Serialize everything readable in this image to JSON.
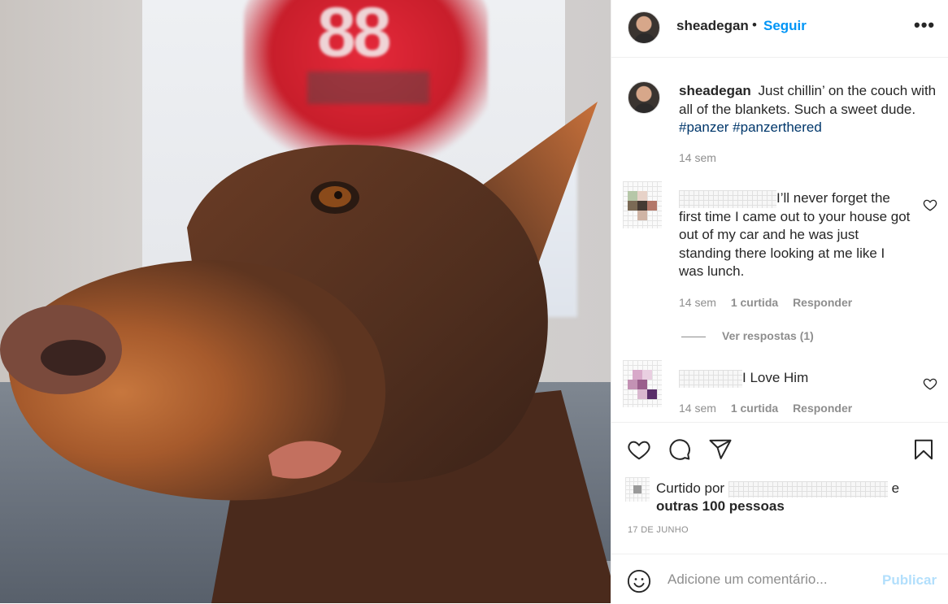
{
  "post": {
    "username": "sheadegan",
    "follow_label": "Seguir",
    "separator": "•",
    "more_label": "•••"
  },
  "caption": {
    "username": "sheadegan",
    "text": "Just chillin’ on the couch with all of the blankets. Such a sweet dude.",
    "hashtags": [
      "#panzer",
      "#panzerthered"
    ],
    "time": "14 sem"
  },
  "comments": [
    {
      "text": "I’ll never forget the first time I came out to your house got out of my car and he was just standing there looking at me like I was lunch.",
      "time": "14 sem",
      "likes": "1 curtida",
      "reply_label": "Responder"
    },
    {
      "text": "I Love Him",
      "time": "14 sem",
      "likes": "1 curtida",
      "reply_label": "Responder"
    }
  ],
  "view_replies": "Ver respostas (1)",
  "likes": {
    "prefix": "Curtido por",
    "connector": "e",
    "others": "outras 100 pessoas"
  },
  "date": "17 DE JUNHO",
  "add_comment": {
    "placeholder": "Adicione um comentário...",
    "publish_label": "Publicar"
  },
  "colors": {
    "link_blue": "#0095f6",
    "hashtag": "#00376b",
    "publish_disabled": "#b2dffc",
    "secondary_text": "#8e8e8e"
  },
  "icons": [
    "heart-icon",
    "comment-icon",
    "share-icon",
    "bookmark-icon",
    "emoji-icon",
    "more-icon"
  ]
}
